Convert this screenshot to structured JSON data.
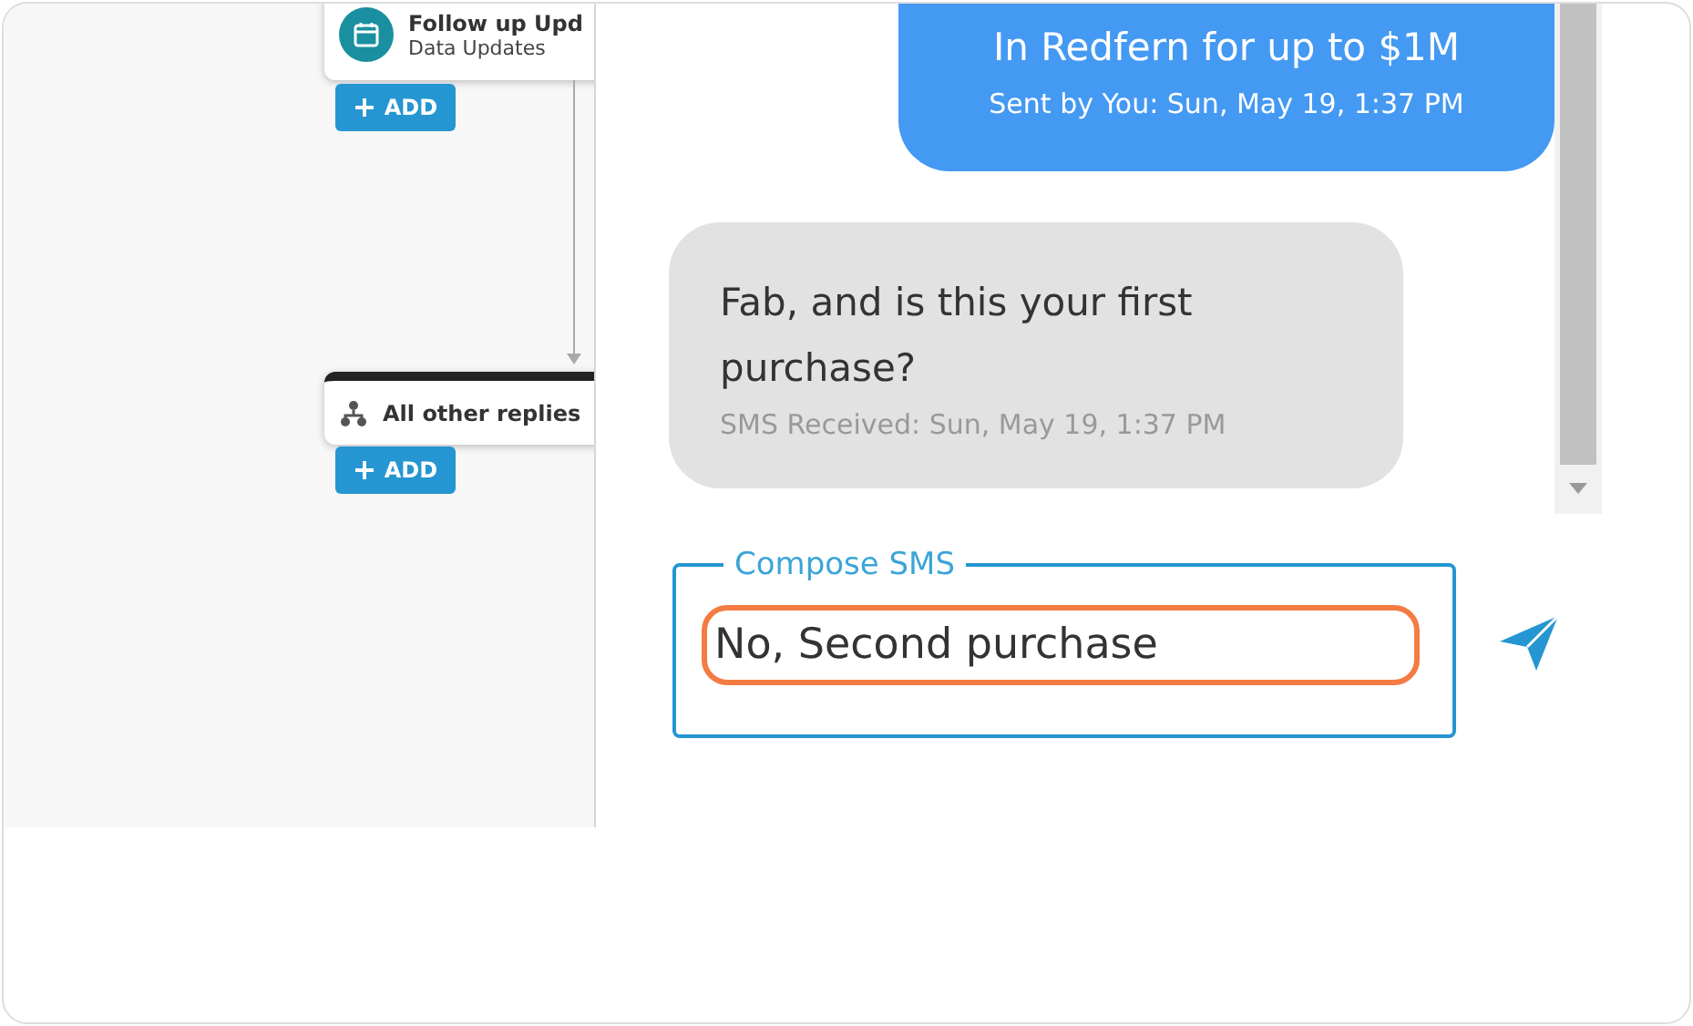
{
  "workflow": {
    "nodes": [
      {
        "kind": "action",
        "title": "Follow up Upd",
        "subtitle": "Data Updates",
        "add_label": "ADD"
      },
      {
        "kind": "branch",
        "title": "All other replies",
        "add_label": "ADD"
      }
    ]
  },
  "chat": {
    "messages": [
      {
        "kind": "outgoing",
        "text": "In Redfern for up to $1M",
        "meta": "Sent by You: Sun, May 19, 1:37 PM"
      },
      {
        "kind": "incoming",
        "text": "Fab, and is this your first purchase?",
        "meta": "SMS Received: Sun, May 19, 1:37 PM"
      }
    ],
    "compose": {
      "label": "Compose SMS",
      "value": "No, Second purchase"
    }
  }
}
